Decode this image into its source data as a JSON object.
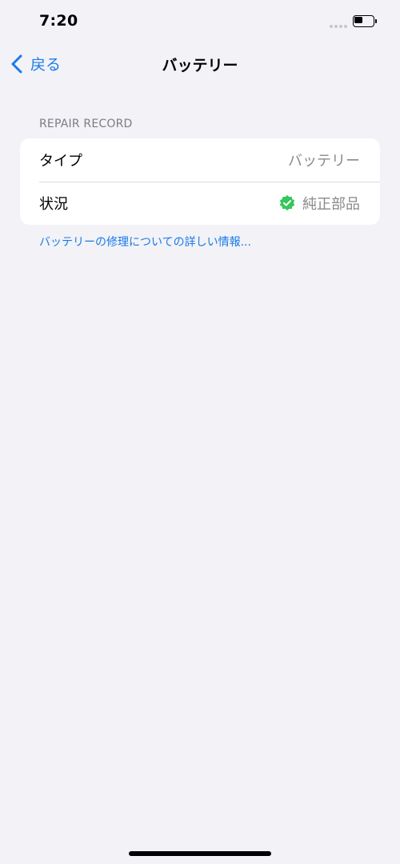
{
  "status_bar": {
    "time": "7:20",
    "battery_level": 0.45
  },
  "nav": {
    "back_label": "戻る",
    "title": "バッテリー"
  },
  "section": {
    "header": "REPAIR RECORD",
    "rows": [
      {
        "label": "タイプ",
        "value": "バッテリー"
      },
      {
        "label": "状況",
        "value": "純正部品",
        "icon": "verified-badge-icon"
      }
    ]
  },
  "info_link": "バッテリーの修理についての詳しい情報...",
  "colors": {
    "accent": "#1a7ae8",
    "verified_green": "#34c759",
    "background": "#f2f2f7"
  }
}
